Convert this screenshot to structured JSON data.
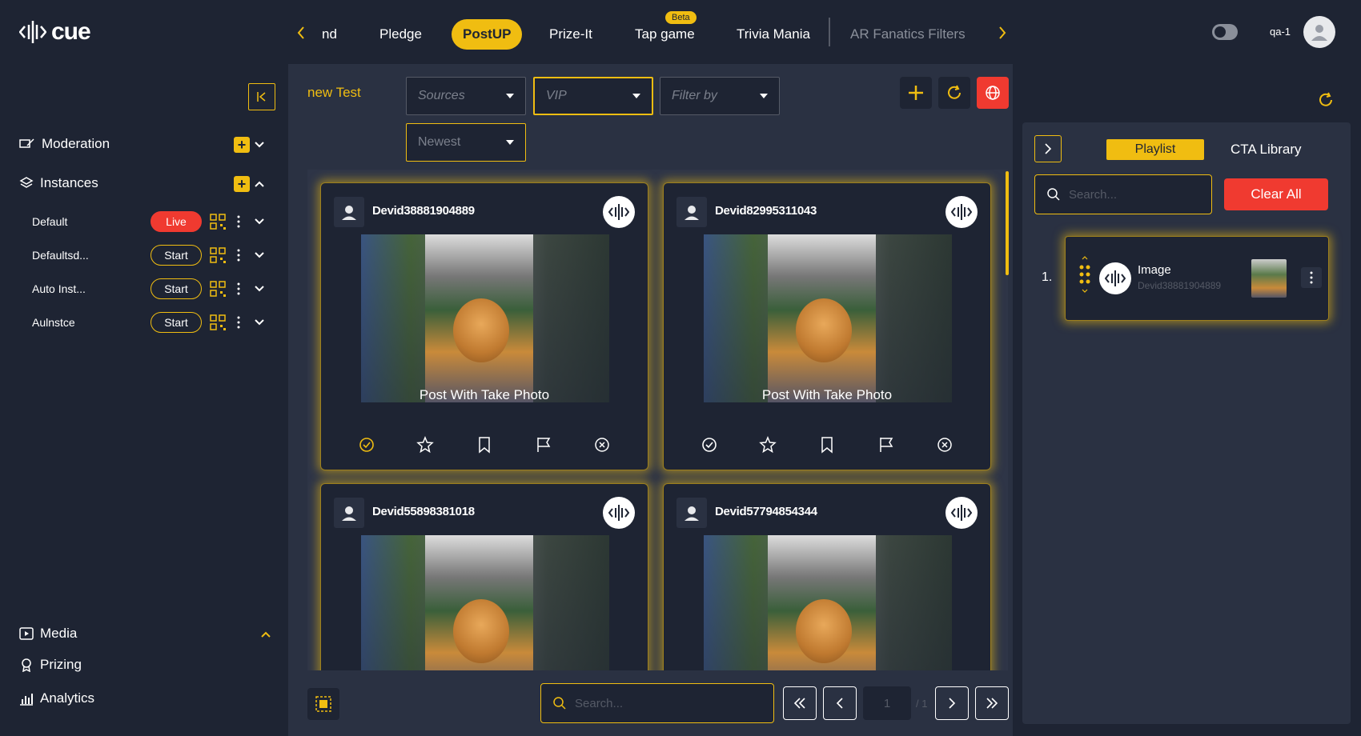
{
  "app": {
    "logo_text": "cue",
    "user": "qa-1"
  },
  "nav": {
    "tabs": [
      {
        "label": "nd"
      },
      {
        "label": "Pledge"
      },
      {
        "label": "PostUP",
        "active": true
      },
      {
        "label": "Prize-It"
      },
      {
        "label": "Tap game",
        "badge": "Beta"
      },
      {
        "label": "Trivia Mania"
      },
      {
        "label": "AR Fanatics Filters"
      }
    ]
  },
  "sidebar": {
    "moderation": "Moderation",
    "instances": "Instances",
    "instance_list": [
      {
        "name": "Default",
        "status": "Live"
      },
      {
        "name": "Defaultsd...",
        "status": "Start"
      },
      {
        "name": "Auto Inst...",
        "status": "Start"
      },
      {
        "name": "Aulnstce",
        "status": "Start"
      }
    ],
    "media": "Media",
    "prizing": "Prizing",
    "analytics": "Analytics"
  },
  "main": {
    "title": "new Test",
    "filters": {
      "sources": "Sources",
      "vip": "VIP",
      "filter_by": "Filter by",
      "sort": "Newest"
    },
    "cards": [
      {
        "user": "Devid38881904889",
        "caption": "Post With Take Photo",
        "approved": true
      },
      {
        "user": "Devid82995311043",
        "caption": "Post With Take Photo",
        "approved": false
      },
      {
        "user": "Devid55898381018",
        "caption": "",
        "approved": false
      },
      {
        "user": "Devid57794854344",
        "caption": "",
        "approved": false
      }
    ],
    "search_placeholder": "Search...",
    "pagination": {
      "current": "1",
      "total": "/ 1"
    }
  },
  "right": {
    "tab_playlist": "Playlist",
    "tab_cta": "CTA Library",
    "search_placeholder": "Search...",
    "clear_all": "Clear All",
    "playlist": [
      {
        "index": "1.",
        "type": "Image",
        "user": "Devid38881904889"
      }
    ]
  },
  "colors": {
    "accent": "#f0bd11",
    "live": "#f03a30",
    "bg": "#1e2433",
    "panel": "#2a3142"
  }
}
